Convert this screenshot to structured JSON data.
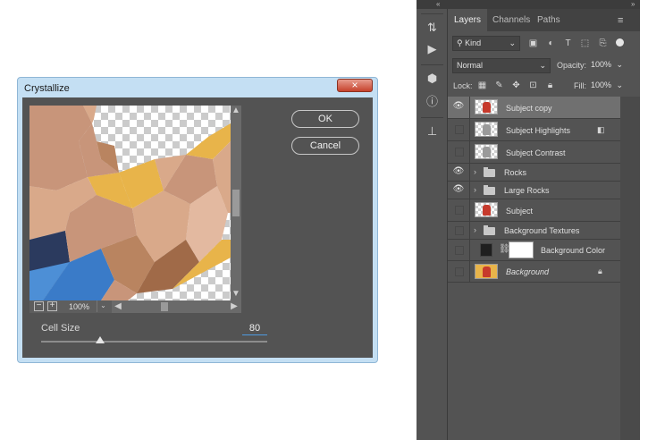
{
  "dialog": {
    "title": "Crystallize",
    "close_label": "×",
    "ok_label": "OK",
    "cancel_label": "Cancel",
    "zoom_out_label": "−",
    "zoom_in_label": "+",
    "zoom_value": "100%",
    "cell_size_label": "Cell Size",
    "cell_size_value": "80",
    "cell_size_min": 3,
    "cell_size_max": 300
  },
  "panel": {
    "tabs": [
      {
        "label": "Layers",
        "active": true
      },
      {
        "label": "Channels",
        "active": false
      },
      {
        "label": "Paths",
        "active": false
      }
    ],
    "filter_kind": "Kind",
    "blend_mode": "Normal",
    "opacity_label": "Opacity:",
    "opacity_value": "100%",
    "lock_label": "Lock:",
    "fill_label": "Fill:",
    "fill_value": "100%",
    "layers": [
      {
        "name": "Subject copy",
        "visible": true,
        "selected": true,
        "kind": "image"
      },
      {
        "name": "Subject Highlights",
        "visible": false,
        "selected": false,
        "kind": "image",
        "badge": "smart-filter-icon"
      },
      {
        "name": "Subject Contrast",
        "visible": false,
        "selected": false,
        "kind": "image"
      },
      {
        "name": "Rocks",
        "visible": true,
        "selected": false,
        "kind": "group"
      },
      {
        "name": "Large Rocks",
        "visible": true,
        "selected": false,
        "kind": "group"
      },
      {
        "name": "Subject",
        "visible": false,
        "selected": false,
        "kind": "image"
      },
      {
        "name": "Background Textures",
        "visible": false,
        "selected": false,
        "kind": "group"
      },
      {
        "name": "Background Color",
        "visible": false,
        "selected": false,
        "kind": "fill"
      },
      {
        "name": "Background",
        "visible": false,
        "selected": false,
        "kind": "background",
        "badge": "lock-icon"
      }
    ]
  },
  "colors": {
    "crystal_palette": [
      "#c8957a",
      "#d9a98a",
      "#e3b9a0",
      "#2b3a5e",
      "#3a7bc8",
      "#e8b44a",
      "#b98460",
      "#a06a48"
    ]
  }
}
